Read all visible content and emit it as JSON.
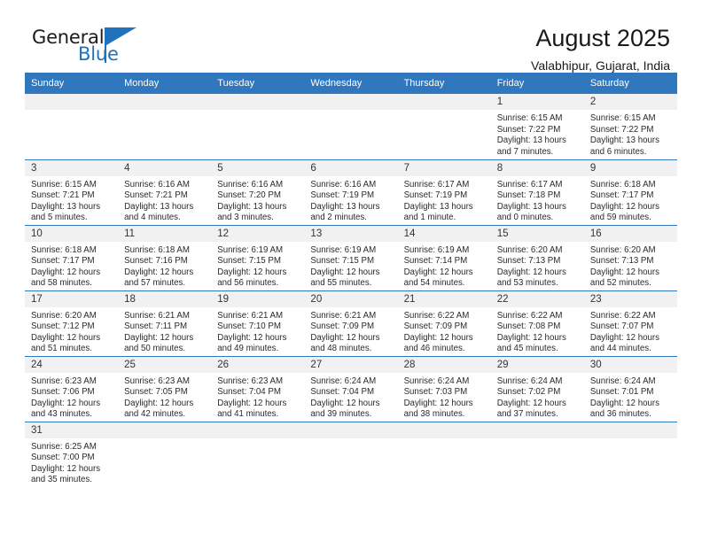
{
  "brand": {
    "name_part1": "General",
    "name_part2": "Blue",
    "accent_color": "#1f73bd"
  },
  "header": {
    "title": "August 2025",
    "subtitle": "Valabhipur, Gujarat, India"
  },
  "calendar": {
    "header_bg": "#3177bd",
    "daynum_bg": "#f1f1f1",
    "weekday_labels": [
      "Sunday",
      "Monday",
      "Tuesday",
      "Wednesday",
      "Thursday",
      "Friday",
      "Saturday"
    ],
    "labels": {
      "sunrise_prefix": "Sunrise: ",
      "sunset_prefix": "Sunset: ",
      "daylight_prefix": "Daylight: "
    },
    "weeks": [
      [
        {
          "day": "",
          "blank": true
        },
        {
          "day": "",
          "blank": true
        },
        {
          "day": "",
          "blank": true
        },
        {
          "day": "",
          "blank": true
        },
        {
          "day": "",
          "blank": true
        },
        {
          "day": "1",
          "sunrise": "Sunrise: 6:15 AM",
          "sunset": "Sunset: 7:22 PM",
          "daylight_line1": "Daylight: 13 hours",
          "daylight_line2": "and 7 minutes."
        },
        {
          "day": "2",
          "sunrise": "Sunrise: 6:15 AM",
          "sunset": "Sunset: 7:22 PM",
          "daylight_line1": "Daylight: 13 hours",
          "daylight_line2": "and 6 minutes."
        }
      ],
      [
        {
          "day": "3",
          "sunrise": "Sunrise: 6:15 AM",
          "sunset": "Sunset: 7:21 PM",
          "daylight_line1": "Daylight: 13 hours",
          "daylight_line2": "and 5 minutes."
        },
        {
          "day": "4",
          "sunrise": "Sunrise: 6:16 AM",
          "sunset": "Sunset: 7:21 PM",
          "daylight_line1": "Daylight: 13 hours",
          "daylight_line2": "and 4 minutes."
        },
        {
          "day": "5",
          "sunrise": "Sunrise: 6:16 AM",
          "sunset": "Sunset: 7:20 PM",
          "daylight_line1": "Daylight: 13 hours",
          "daylight_line2": "and 3 minutes."
        },
        {
          "day": "6",
          "sunrise": "Sunrise: 6:16 AM",
          "sunset": "Sunset: 7:19 PM",
          "daylight_line1": "Daylight: 13 hours",
          "daylight_line2": "and 2 minutes."
        },
        {
          "day": "7",
          "sunrise": "Sunrise: 6:17 AM",
          "sunset": "Sunset: 7:19 PM",
          "daylight_line1": "Daylight: 13 hours",
          "daylight_line2": "and 1 minute."
        },
        {
          "day": "8",
          "sunrise": "Sunrise: 6:17 AM",
          "sunset": "Sunset: 7:18 PM",
          "daylight_line1": "Daylight: 13 hours",
          "daylight_line2": "and 0 minutes."
        },
        {
          "day": "9",
          "sunrise": "Sunrise: 6:18 AM",
          "sunset": "Sunset: 7:17 PM",
          "daylight_line1": "Daylight: 12 hours",
          "daylight_line2": "and 59 minutes."
        }
      ],
      [
        {
          "day": "10",
          "sunrise": "Sunrise: 6:18 AM",
          "sunset": "Sunset: 7:17 PM",
          "daylight_line1": "Daylight: 12 hours",
          "daylight_line2": "and 58 minutes."
        },
        {
          "day": "11",
          "sunrise": "Sunrise: 6:18 AM",
          "sunset": "Sunset: 7:16 PM",
          "daylight_line1": "Daylight: 12 hours",
          "daylight_line2": "and 57 minutes."
        },
        {
          "day": "12",
          "sunrise": "Sunrise: 6:19 AM",
          "sunset": "Sunset: 7:15 PM",
          "daylight_line1": "Daylight: 12 hours",
          "daylight_line2": "and 56 minutes."
        },
        {
          "day": "13",
          "sunrise": "Sunrise: 6:19 AM",
          "sunset": "Sunset: 7:15 PM",
          "daylight_line1": "Daylight: 12 hours",
          "daylight_line2": "and 55 minutes."
        },
        {
          "day": "14",
          "sunrise": "Sunrise: 6:19 AM",
          "sunset": "Sunset: 7:14 PM",
          "daylight_line1": "Daylight: 12 hours",
          "daylight_line2": "and 54 minutes."
        },
        {
          "day": "15",
          "sunrise": "Sunrise: 6:20 AM",
          "sunset": "Sunset: 7:13 PM",
          "daylight_line1": "Daylight: 12 hours",
          "daylight_line2": "and 53 minutes."
        },
        {
          "day": "16",
          "sunrise": "Sunrise: 6:20 AM",
          "sunset": "Sunset: 7:13 PM",
          "daylight_line1": "Daylight: 12 hours",
          "daylight_line2": "and 52 minutes."
        }
      ],
      [
        {
          "day": "17",
          "sunrise": "Sunrise: 6:20 AM",
          "sunset": "Sunset: 7:12 PM",
          "daylight_line1": "Daylight: 12 hours",
          "daylight_line2": "and 51 minutes."
        },
        {
          "day": "18",
          "sunrise": "Sunrise: 6:21 AM",
          "sunset": "Sunset: 7:11 PM",
          "daylight_line1": "Daylight: 12 hours",
          "daylight_line2": "and 50 minutes."
        },
        {
          "day": "19",
          "sunrise": "Sunrise: 6:21 AM",
          "sunset": "Sunset: 7:10 PM",
          "daylight_line1": "Daylight: 12 hours",
          "daylight_line2": "and 49 minutes."
        },
        {
          "day": "20",
          "sunrise": "Sunrise: 6:21 AM",
          "sunset": "Sunset: 7:09 PM",
          "daylight_line1": "Daylight: 12 hours",
          "daylight_line2": "and 48 minutes."
        },
        {
          "day": "21",
          "sunrise": "Sunrise: 6:22 AM",
          "sunset": "Sunset: 7:09 PM",
          "daylight_line1": "Daylight: 12 hours",
          "daylight_line2": "and 46 minutes."
        },
        {
          "day": "22",
          "sunrise": "Sunrise: 6:22 AM",
          "sunset": "Sunset: 7:08 PM",
          "daylight_line1": "Daylight: 12 hours",
          "daylight_line2": "and 45 minutes."
        },
        {
          "day": "23",
          "sunrise": "Sunrise: 6:22 AM",
          "sunset": "Sunset: 7:07 PM",
          "daylight_line1": "Daylight: 12 hours",
          "daylight_line2": "and 44 minutes."
        }
      ],
      [
        {
          "day": "24",
          "sunrise": "Sunrise: 6:23 AM",
          "sunset": "Sunset: 7:06 PM",
          "daylight_line1": "Daylight: 12 hours",
          "daylight_line2": "and 43 minutes."
        },
        {
          "day": "25",
          "sunrise": "Sunrise: 6:23 AM",
          "sunset": "Sunset: 7:05 PM",
          "daylight_line1": "Daylight: 12 hours",
          "daylight_line2": "and 42 minutes."
        },
        {
          "day": "26",
          "sunrise": "Sunrise: 6:23 AM",
          "sunset": "Sunset: 7:04 PM",
          "daylight_line1": "Daylight: 12 hours",
          "daylight_line2": "and 41 minutes."
        },
        {
          "day": "27",
          "sunrise": "Sunrise: 6:24 AM",
          "sunset": "Sunset: 7:04 PM",
          "daylight_line1": "Daylight: 12 hours",
          "daylight_line2": "and 39 minutes."
        },
        {
          "day": "28",
          "sunrise": "Sunrise: 6:24 AM",
          "sunset": "Sunset: 7:03 PM",
          "daylight_line1": "Daylight: 12 hours",
          "daylight_line2": "and 38 minutes."
        },
        {
          "day": "29",
          "sunrise": "Sunrise: 6:24 AM",
          "sunset": "Sunset: 7:02 PM",
          "daylight_line1": "Daylight: 12 hours",
          "daylight_line2": "and 37 minutes."
        },
        {
          "day": "30",
          "sunrise": "Sunrise: 6:24 AM",
          "sunset": "Sunset: 7:01 PM",
          "daylight_line1": "Daylight: 12 hours",
          "daylight_line2": "and 36 minutes."
        }
      ],
      [
        {
          "day": "31",
          "sunrise": "Sunrise: 6:25 AM",
          "sunset": "Sunset: 7:00 PM",
          "daylight_line1": "Daylight: 12 hours",
          "daylight_line2": "and 35 minutes."
        },
        {
          "day": "",
          "blank": true
        },
        {
          "day": "",
          "blank": true
        },
        {
          "day": "",
          "blank": true
        },
        {
          "day": "",
          "blank": true
        },
        {
          "day": "",
          "blank": true
        },
        {
          "day": "",
          "blank": true
        }
      ]
    ]
  }
}
